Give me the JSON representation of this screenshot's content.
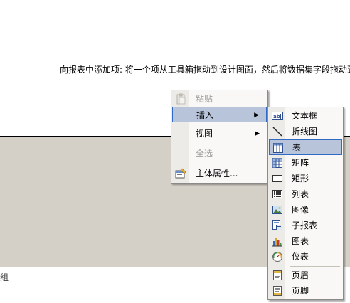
{
  "design_surface": {
    "hint": "向报表中添加项: 将一个项从工具箱拖动到设计图面，然后将数据集字段拖动到"
  },
  "group_bar": {
    "text": "组"
  },
  "context_menu": {
    "items": [
      {
        "label": "粘贴",
        "icon": "paste-icon",
        "disabled": true
      },
      {
        "label": "插入",
        "submenu": true,
        "selected": true
      },
      {
        "label": "视图",
        "submenu": true
      },
      {
        "label": "全选",
        "disabled": true
      },
      {
        "label": "主体属性...",
        "icon": "properties-icon"
      }
    ]
  },
  "insert_submenu": {
    "items": [
      {
        "label": "文本框",
        "icon": "textbox-icon"
      },
      {
        "label": "折线图",
        "icon": "line-icon"
      },
      {
        "label": "表",
        "icon": "table-icon",
        "selected": true
      },
      {
        "label": "矩阵",
        "icon": "matrix-icon"
      },
      {
        "label": "矩形",
        "icon": "rectangle-icon"
      },
      {
        "label": "列表",
        "icon": "list-icon"
      },
      {
        "label": "图像",
        "icon": "image-icon"
      },
      {
        "label": "子报表",
        "icon": "subreport-icon"
      },
      {
        "label": "图表",
        "icon": "chart-icon"
      },
      {
        "label": "仪表",
        "icon": "gauge-icon"
      },
      {
        "label": "页眉",
        "icon": "page-header-icon"
      },
      {
        "label": "页脚",
        "icon": "page-footer-icon"
      }
    ]
  },
  "colors": {
    "selection_fill": "#b8c4da",
    "selection_border": "#316ac5",
    "body_band": "#d4d0c8",
    "disabled_text": "#a0a0a0"
  }
}
